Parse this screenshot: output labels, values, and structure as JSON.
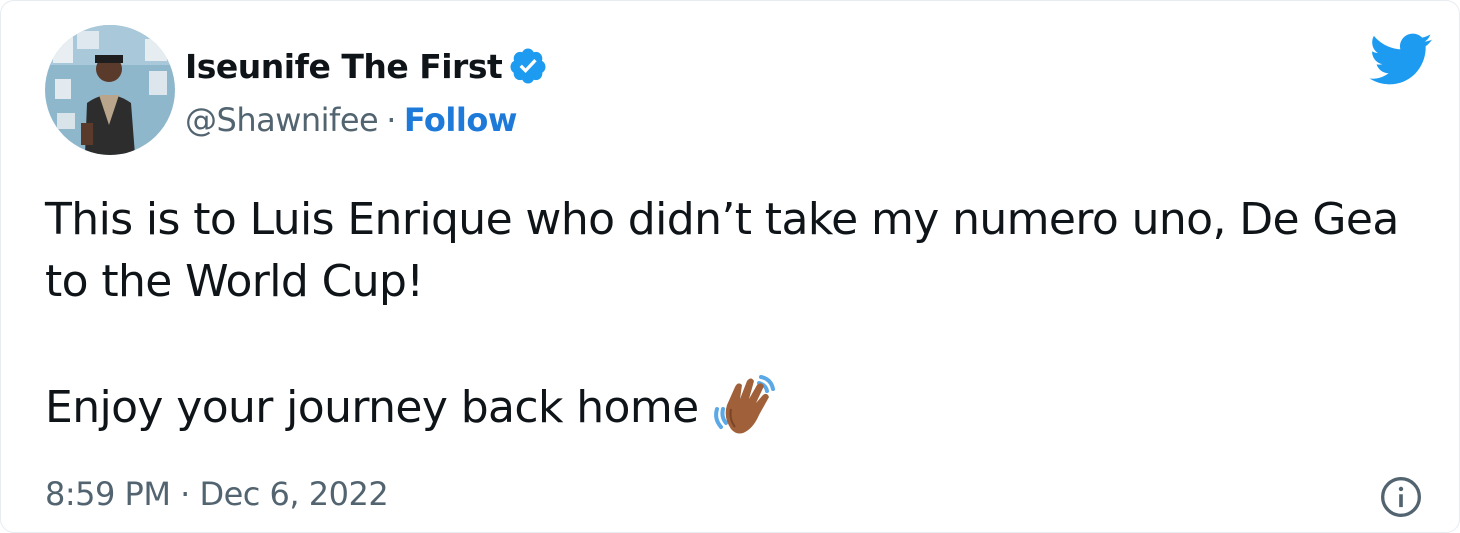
{
  "author": {
    "display_name": "Iseunife The First",
    "handle": "@Shawnifee",
    "separator": "·",
    "follow_label": "Follow",
    "verified": true,
    "verified_badge_icon": "verified-badge-icon",
    "avatar_icon": "avatar-photo"
  },
  "brand": {
    "logo_icon": "twitter-bird-icon",
    "accent_color": "#1d9bf0",
    "follow_color": "#1d7ad8"
  },
  "tweet": {
    "paragraph_1": "This is to Luis Enrique who didn’t take my numero uno, De Gea to the World Cup!",
    "paragraph_2": "Enjoy your journey back home",
    "emoji_icon": "waving-hand-icon"
  },
  "footer": {
    "timestamp": "8:59 PM · Dec 6, 2022",
    "info_icon": "info-icon"
  }
}
